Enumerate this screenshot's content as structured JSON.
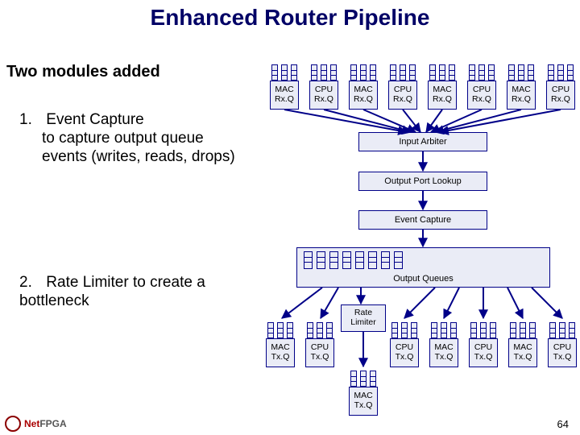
{
  "title": "Enhanced Router Pipeline",
  "subtitle": "Two modules added",
  "item1": {
    "num": "1.",
    "head": "Event Capture",
    "sub": "to capture output queue events (writes, reads, drops)"
  },
  "item2": {
    "num": "2.",
    "head": "Rate Limiter",
    "tail": " to create a bottleneck"
  },
  "rx": [
    {
      "l": "MAC Rx.Q"
    },
    {
      "l": "CPU Rx.Q"
    },
    {
      "l": "MAC Rx.Q"
    },
    {
      "l": "CPU Rx.Q"
    },
    {
      "l": "MAC Rx.Q"
    },
    {
      "l": "CPU Rx.Q"
    },
    {
      "l": "MAC Rx.Q"
    },
    {
      "l": "CPU Rx.Q"
    }
  ],
  "mid": {
    "arbiter": "Input Arbiter",
    "lookup": "Output Port Lookup",
    "ecap": "Event Capture",
    "oq": "Output Queues",
    "rl": "Rate Limiter"
  },
  "tx_top": [
    {
      "l": "MAC Tx.Q"
    },
    {
      "l": "CPU Tx.Q"
    },
    {
      "l": "CPU Tx.Q"
    },
    {
      "l": "MAC Tx.Q"
    },
    {
      "l": "CPU Tx.Q"
    },
    {
      "l": "MAC Tx.Q"
    },
    {
      "l": "CPU Tx.Q"
    }
  ],
  "tx_bottom": {
    "l": "MAC Tx.Q"
  },
  "page": "64",
  "logo": {
    "brand_a": "Net",
    "brand_b": "FPGA"
  }
}
